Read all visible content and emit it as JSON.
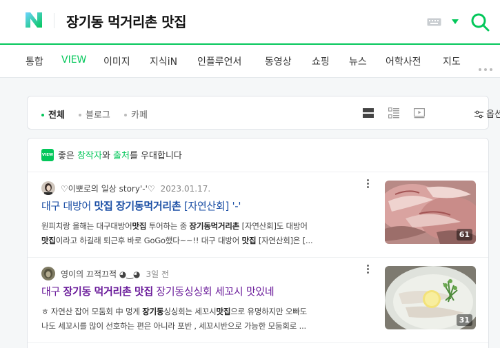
{
  "search": {
    "query": "장기동 먹거리촌 맛집"
  },
  "tabs": [
    "통합",
    "VIEW",
    "이미지",
    "지식iN",
    "인플루언서",
    "동영상",
    "쇼핑",
    "뉴스",
    "어학사전",
    "지도"
  ],
  "active_tab": "VIEW",
  "filter": {
    "items": [
      "전체",
      "블로그",
      "카페"
    ],
    "active": "전체",
    "options_label": "옵션"
  },
  "notice": {
    "badge": "VIEW",
    "prefix": "좋은 ",
    "creator": "창작자",
    "middle": "와 ",
    "source": "출처",
    "suffix": "를 우대합니다"
  },
  "posts": [
    {
      "author": "♡이뽀로의 일상 story'-'♡",
      "date": "2023.01.17.",
      "title": {
        "p1": "대구 대방어 ",
        "b1": "맛집",
        "p2": " ",
        "b2": "장기동먹거리촌",
        "p3": " [자연산회] '-'"
      },
      "snippet_line1": {
        "t1": "원피치랑 올해는 대구대방어",
        "b1": "맛집",
        "t2": " 투어하는 중 ",
        "b2": "장기동먹거리촌",
        "t3": " [자연산회]도 대방어"
      },
      "snippet_line2": {
        "b1": "맛집",
        "t1": "이라고 하길래 퇴근후 바로 GoGo했다~~!! 대구 대방어 ",
        "b2": "맛집",
        "t2": " [자연산회]은 [..."
      },
      "image_count": "61"
    },
    {
      "author": "영이의 끄적끄적 ◕‿◕",
      "date": "3일 전",
      "title": {
        "p1": "대구 ",
        "b1": "장기동",
        "p2": " ",
        "b2": "먹거리촌",
        "p3": " ",
        "b3": "맛집",
        "p4": " 장기동싱싱회 세꼬시 맛있네"
      },
      "snippet_line1": {
        "t1": "ㅎ 자연산 잡어 모둠회 中 멍게 ",
        "b1": "장기동",
        "t2": "싱싱회는 세꼬시",
        "b2": "맛집",
        "t3": "으로 유명하지만 오빠도"
      },
      "snippet_line2": {
        "t1": "나도 세꼬시를 많이 선호하는 편은 아니라 포반 , 세꼬시반으로 가능한 모둠회로 ..."
      },
      "image_count": "31"
    }
  ],
  "colors": {
    "brand_green": "#03c75a",
    "title_blue": "#1a4ea5",
    "title_visited": "#6a1b9a"
  }
}
